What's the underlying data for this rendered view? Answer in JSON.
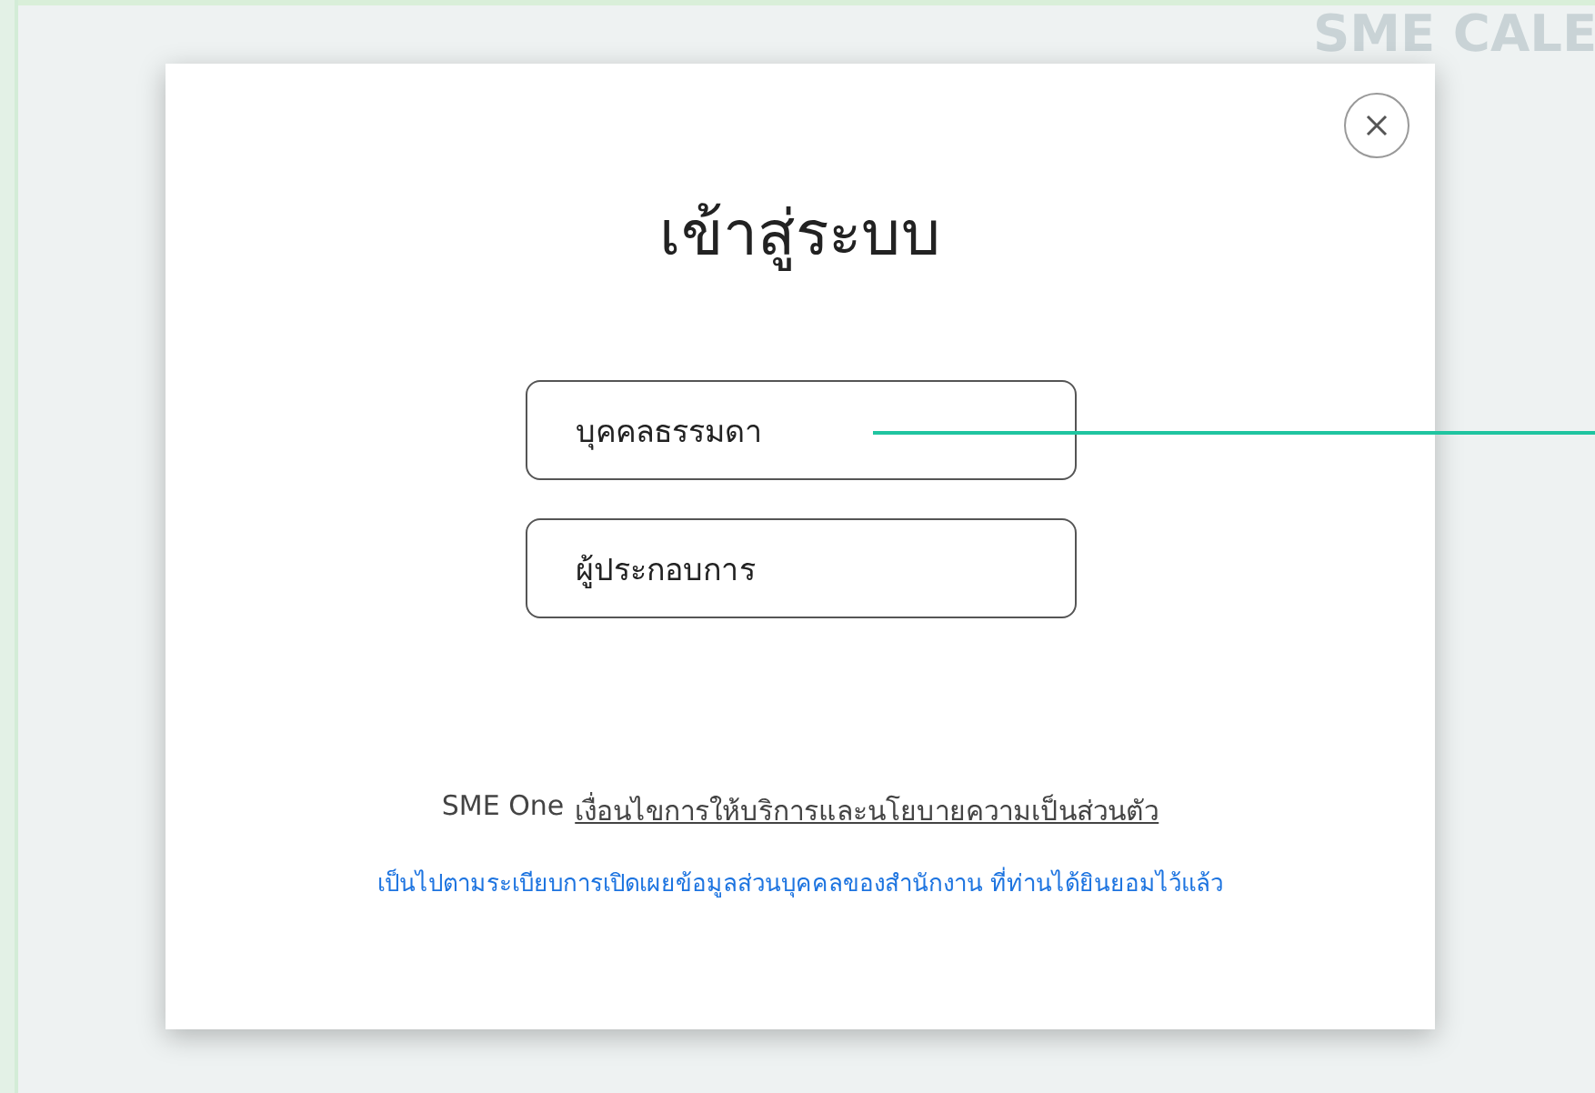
{
  "background": {
    "heading": "SME CALE"
  },
  "dialog": {
    "title": "เข้าสู่ระบบ",
    "options": [
      {
        "label": "บุคคลธรรมดา"
      },
      {
        "label": "ผู้ประกอบการ"
      }
    ],
    "terms": {
      "prefix": "SME One",
      "link": "เงื่อนไขการให้บริการและนโยบายความเป็นส่วนตัว"
    },
    "notice": "เป็นไปตามระเบียบการเปิดเผยข้อมูลส่วนบุคคลของสำนักงาน ที่ท่านได้ยินยอมไว้แล้ว"
  }
}
